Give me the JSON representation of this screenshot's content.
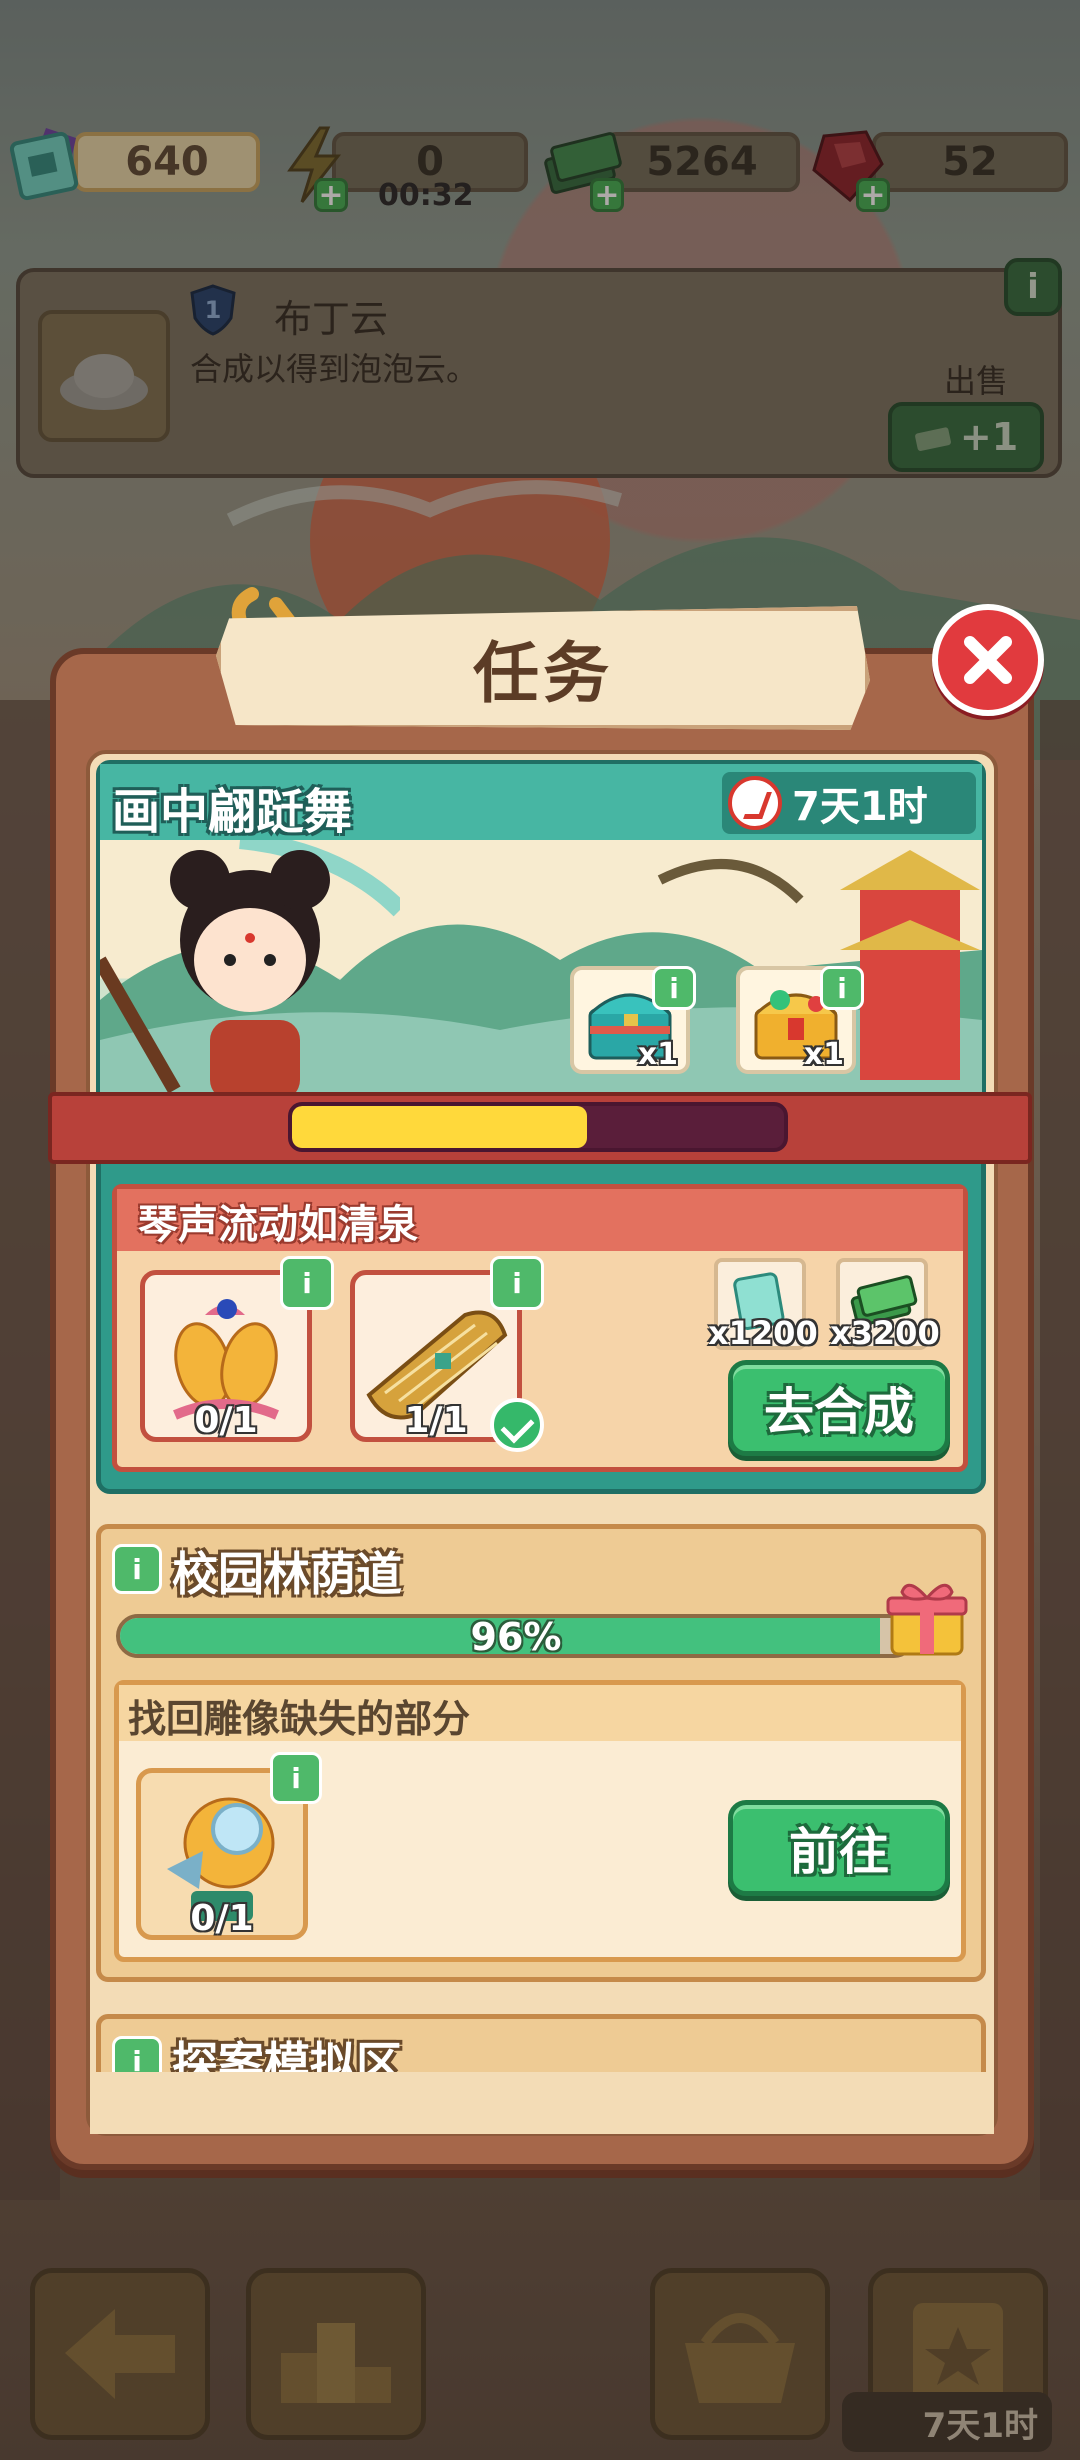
{
  "resources": [
    {
      "icon": "ticket-icon",
      "value": "640"
    },
    {
      "icon": "energy-icon",
      "value": "0",
      "timer": "00:32"
    },
    {
      "icon": "cash-icon",
      "value": "5264"
    },
    {
      "icon": "ruby-icon",
      "value": "52"
    }
  ],
  "info_card": {
    "level": "1",
    "name": "布丁云",
    "desc": "合成以得到泡泡云。",
    "sell_label": "出售",
    "sell_value": "+1",
    "info_label": "i"
  },
  "panel": {
    "title": "任务",
    "event": {
      "title": "画中翩跹舞",
      "timer": "7天1时",
      "progress": 0.6,
      "rewards": [
        {
          "icon": "teal-chest-icon",
          "qty": "x1"
        },
        {
          "icon": "gold-chest-icon",
          "qty": "x1"
        }
      ],
      "quest": {
        "title": "琴声流动如清泉",
        "items": [
          {
            "icon": "golden-fish-icon",
            "count": "0/1",
            "done": false
          },
          {
            "icon": "guzheng-icon",
            "count": "1/1",
            "done": true
          }
        ],
        "rewards": [
          {
            "icon": "ticket-icon",
            "qty": "x1200"
          },
          {
            "icon": "cash-icon",
            "qty": "x3200"
          }
        ],
        "button": "去合成"
      }
    },
    "section2": {
      "title": "校园林荫道",
      "progress_text": "96%",
      "progress": 0.96,
      "task": {
        "title": "找回雕像缺失的部分",
        "item": {
          "icon": "statue-part-icon",
          "count": "0/1"
        },
        "button": "前往"
      }
    },
    "section3": {
      "title": "探案模拟区"
    }
  },
  "bottom_bar": {
    "timer": "7天1时"
  },
  "colors": {
    "accent_green": "#3bbf6f",
    "close_red": "#e13a3e",
    "event_teal": "#2f9a8a",
    "progress_yellow": "#ffd93b"
  }
}
